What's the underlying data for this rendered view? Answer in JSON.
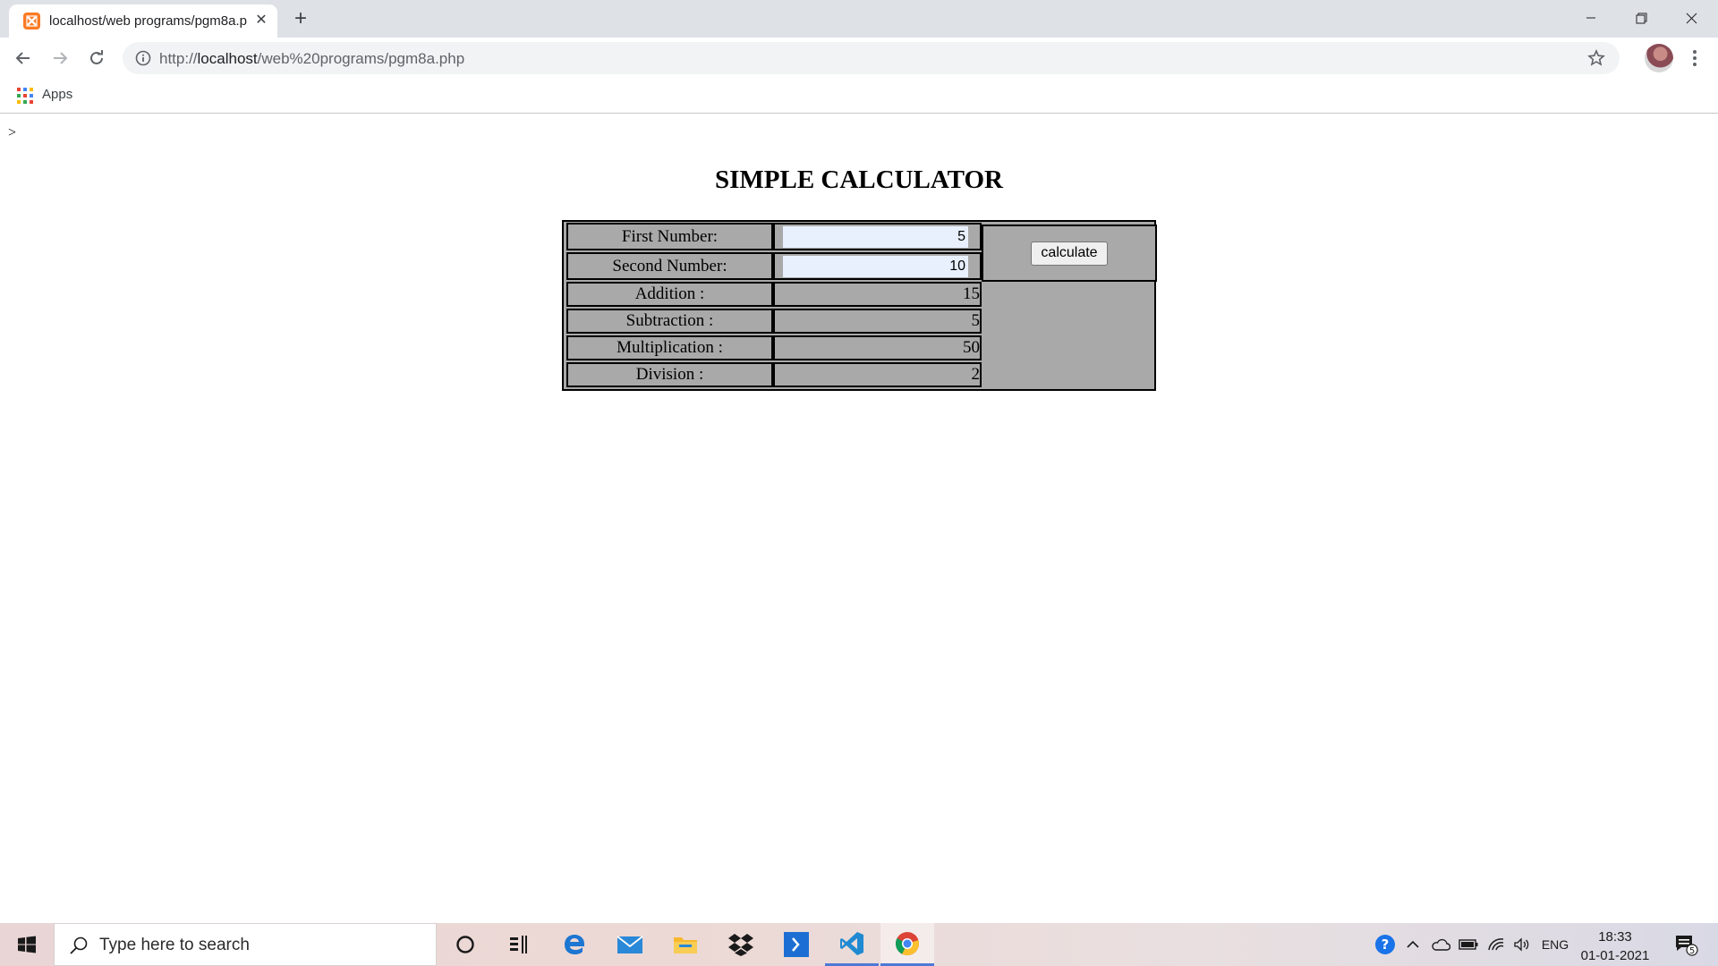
{
  "browser": {
    "tab_title": "localhost/web programs/pgm8a.php",
    "url_prefix": "http://",
    "url_host": "localhost",
    "url_path": "/web%20programs/pgm8a.php",
    "bookmarks": {
      "apps_label": "Apps"
    }
  },
  "page": {
    "stray_text": ">",
    "title": "SIMPLE CALCULATOR",
    "form": {
      "first_label": "First Number:",
      "first_value": "5",
      "second_label": "Second Number:",
      "second_value": "10",
      "button_label": "calculate"
    },
    "results": [
      {
        "label": "Addition :",
        "value": "15"
      },
      {
        "label": "Subtraction :",
        "value": "5"
      },
      {
        "label": "Multiplication :",
        "value": "50"
      },
      {
        "label": "Division :",
        "value": "2"
      }
    ]
  },
  "taskbar": {
    "search_placeholder": "Type here to search",
    "language": "ENG",
    "time": "18:33",
    "date": "01-01-2021",
    "notification_count": "5"
  },
  "colors": {
    "table_bg": "#a9a9a9",
    "input_bg": "#e8f0fe",
    "tab_accent": "#fb7a24"
  }
}
